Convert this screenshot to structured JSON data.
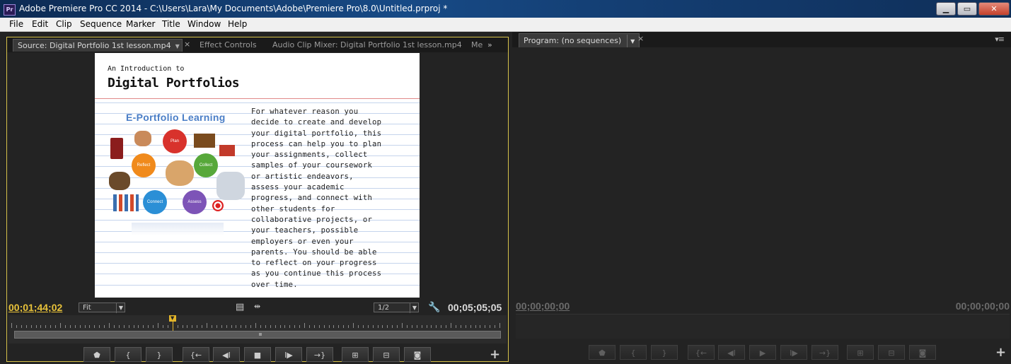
{
  "window": {
    "title": "Adobe Premiere Pro CC 2014 - C:\\Users\\Lara\\My Documents\\Adobe\\Premiere Pro\\8.0\\Untitled.prproj *",
    "app_icon": "Pr",
    "buttons": {
      "minimize": "▁",
      "maximize": "▭",
      "close": "✕"
    }
  },
  "menu": [
    "File",
    "Edit",
    "Clip",
    "Sequence",
    "Marker",
    "Title",
    "Window",
    "Help"
  ],
  "source_panel": {
    "tabs": [
      {
        "label": "Source: Digital Portfolio 1st lesson.mp4",
        "active": true
      },
      {
        "label": "Effect Controls",
        "active": false
      },
      {
        "label": "Audio Clip Mixer: Digital Portfolio 1st lesson.mp4",
        "active": false
      },
      {
        "label": "Me",
        "active": false
      }
    ],
    "frame": {
      "intro": "An Introduction to",
      "heading": "Digital Portfolios",
      "diagram_title": "E-Portfolio Learning",
      "cycle_labels": [
        "Plan",
        "Collect",
        "Assess",
        "Connect",
        "Reflect"
      ],
      "body": "For whatever reason you\ndecide to create and develop\nyour digital portfolio, this\nprocess can help you to plan\nyour assignments, collect\nsamples of your coursework\nor artistic endeavors,\nassess your academic\nprogress, and connect with\nother students for\ncollaborative projects, or\nyour teachers, possible\nemployers or even your\nparents. You should be able\nto reflect on your progress\nas you continue this process\nover time."
    },
    "timecode_current": "00;01;44;02",
    "timecode_duration": "00;05;05;05",
    "zoom_select": "Fit",
    "resolution_select": "1/2",
    "playhead_fraction": 0.33
  },
  "program_panel": {
    "tab_label": "Program: (no sequences)",
    "timecode_current": "00;00;00;00",
    "timecode_duration": "00;00;00;00"
  },
  "colors": {
    "accent": "#e8c23a",
    "panel_bg": "#232323",
    "titlebar": "#174a86"
  }
}
